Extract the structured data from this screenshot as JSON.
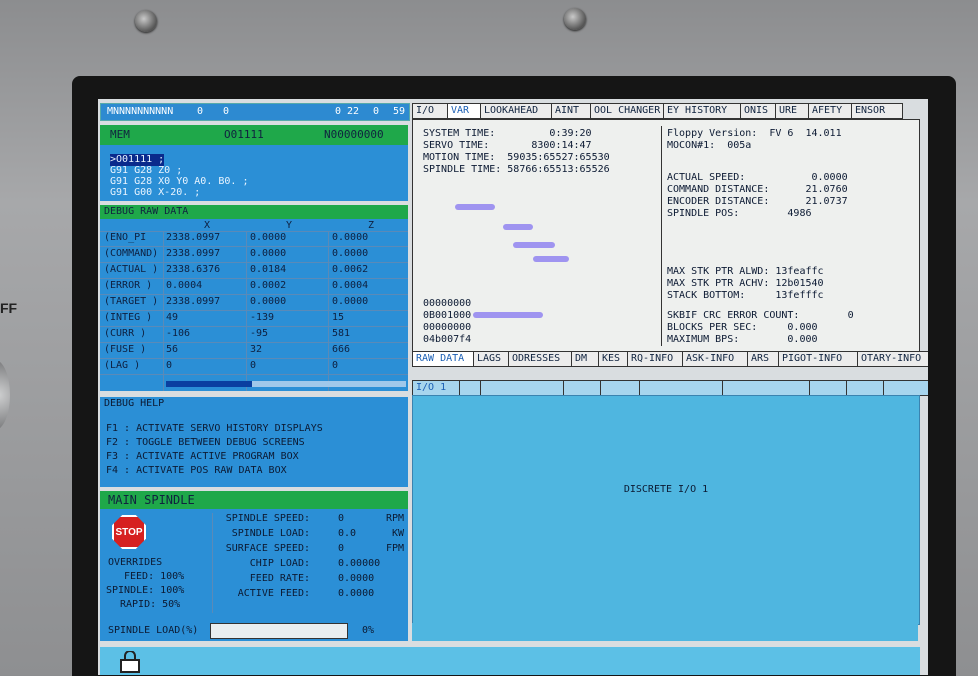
{
  "status_bar": {
    "left": "MNNNNNNNNNN",
    "a": "0",
    "b": "0",
    "right1": "0 22",
    "right2": "0",
    "right3": "59"
  },
  "mem": {
    "label": "MEM",
    "program": "O01111",
    "line": "N00000000"
  },
  "program_lines": [
    ">O01111 ;",
    "G91 G28 Z0 ;",
    "G91 G28 X0 Y0 A0. B0. ;",
    "G91 G00 X-20. ;"
  ],
  "debug_raw": {
    "title": "DEBUG RAW DATA",
    "columns": [
      "X",
      "Y",
      "Z"
    ],
    "rows": [
      {
        "label": "(ENO_PI",
        "x": "2338.0997",
        "y": "0.0000",
        "z": "0.0000"
      },
      {
        "label": "(COMMAND)",
        "x": "2338.0997",
        "y": "0.0000",
        "z": "0.0000"
      },
      {
        "label": "(ACTUAL )",
        "x": "2338.6376",
        "y": "0.0184",
        "z": "0.0062"
      },
      {
        "label": "(ERROR )",
        "x": "0.0004",
        "y": "0.0002",
        "z": "0.0004"
      },
      {
        "label": "(TARGET )",
        "x": "2338.0997",
        "y": "0.0000",
        "z": "0.0000"
      },
      {
        "label": "(INTEG )",
        "x": "49",
        "y": "-139",
        "z": "15"
      },
      {
        "label": "(CURR )",
        "x": "-106",
        "y": "-95",
        "z": "581"
      },
      {
        "label": "(FUSE )",
        "x": "56",
        "y": "32",
        "z": "666"
      },
      {
        "label": "(LAG )",
        "x": "0",
        "y": "0",
        "z": "0"
      }
    ]
  },
  "debug_help": {
    "title": "DEBUG HELP",
    "lines": [
      "F1 : ACTIVATE SERVO HISTORY DISPLAYS",
      "F2 : TOGGLE BETWEEN DEBUG SCREENS",
      "F3 : ACTIVATE ACTIVE PROGRAM BOX",
      "F4 : ACTIVATE POS RAW DATA BOX"
    ]
  },
  "main_spindle": {
    "title": "MAIN SPINDLE",
    "stop": "STOP",
    "overrides_label": "OVERRIDES",
    "feed": "FEED: 100%",
    "spindle": "SPINDLE: 100%",
    "rapid": "RAPID: 50%",
    "rows": [
      {
        "label": "SPINDLE SPEED:",
        "value": "0",
        "unit": "RPM"
      },
      {
        "label": "SPINDLE LOAD:",
        "value": "0.0",
        "unit": "KW"
      },
      {
        "label": "SURFACE SPEED:",
        "value": "0",
        "unit": "FPM"
      },
      {
        "label": "CHIP LOAD:",
        "value": "0.00000",
        "unit": ""
      },
      {
        "label": "FEED RATE:",
        "value": "0.0000",
        "unit": ""
      },
      {
        "label": "ACTIVE FEED:",
        "value": "0.0000",
        "unit": ""
      }
    ],
    "load_label": "SPINDLE LOAD(%)",
    "load_value": "0%",
    "load_fraction": 0
  },
  "top_tabs": [
    "I/O",
    "VAR",
    "LOOKAHEAD",
    "AINT",
    "OOL CHANGER",
    "EY HISTORY",
    "ONIS",
    "URE",
    "AFETY",
    "ENSOR"
  ],
  "var_panel": {
    "left": [
      "SYSTEM TIME:         0:39:20",
      "SERVO TIME:       8300:14:47",
      "MOTION TIME:  59035:65527:65530",
      "SPINDLE TIME: 58766:65513:65526"
    ],
    "right_top": [
      "Floppy Version:  FV 6  14.011",
      "MOCON#1:  005a"
    ],
    "right_mid": [
      "ACTUAL SPEED:           0.0000",
      "COMMAND DISTANCE:      21.0760",
      "ENCODER DISTANCE:      21.0737",
      "SPINDLE POS:        4986"
    ],
    "right_low": [
      "MAX STK PTR ALWD: 13feaffc",
      "MAX STK PTR ACHV: 12b01540",
      "STACK BOTTOM:     13fefffc"
    ],
    "right_bottom": [
      "SKBIF CRC ERROR COUNT:        0",
      "BLOCKS PER SEC:     0.000",
      "MAXIMUM BPS:        0.000"
    ],
    "hex_lines": [
      "00000000",
      "0B001000",
      "00000000",
      "04b007f4"
    ]
  },
  "sub_tabs": [
    "RAW DATA",
    "LAGS",
    "ODRESSES",
    "DM",
    "KES",
    "RQ-INFO",
    "ASK-INFO",
    "ARS",
    "PIGOT-INFO",
    "OTARY-INFO"
  ],
  "io_tabs": [
    "I/O 1",
    "",
    "",
    "",
    "",
    "",
    "",
    "",
    "",
    ""
  ],
  "io_center": "DISCRETE I/O 1"
}
